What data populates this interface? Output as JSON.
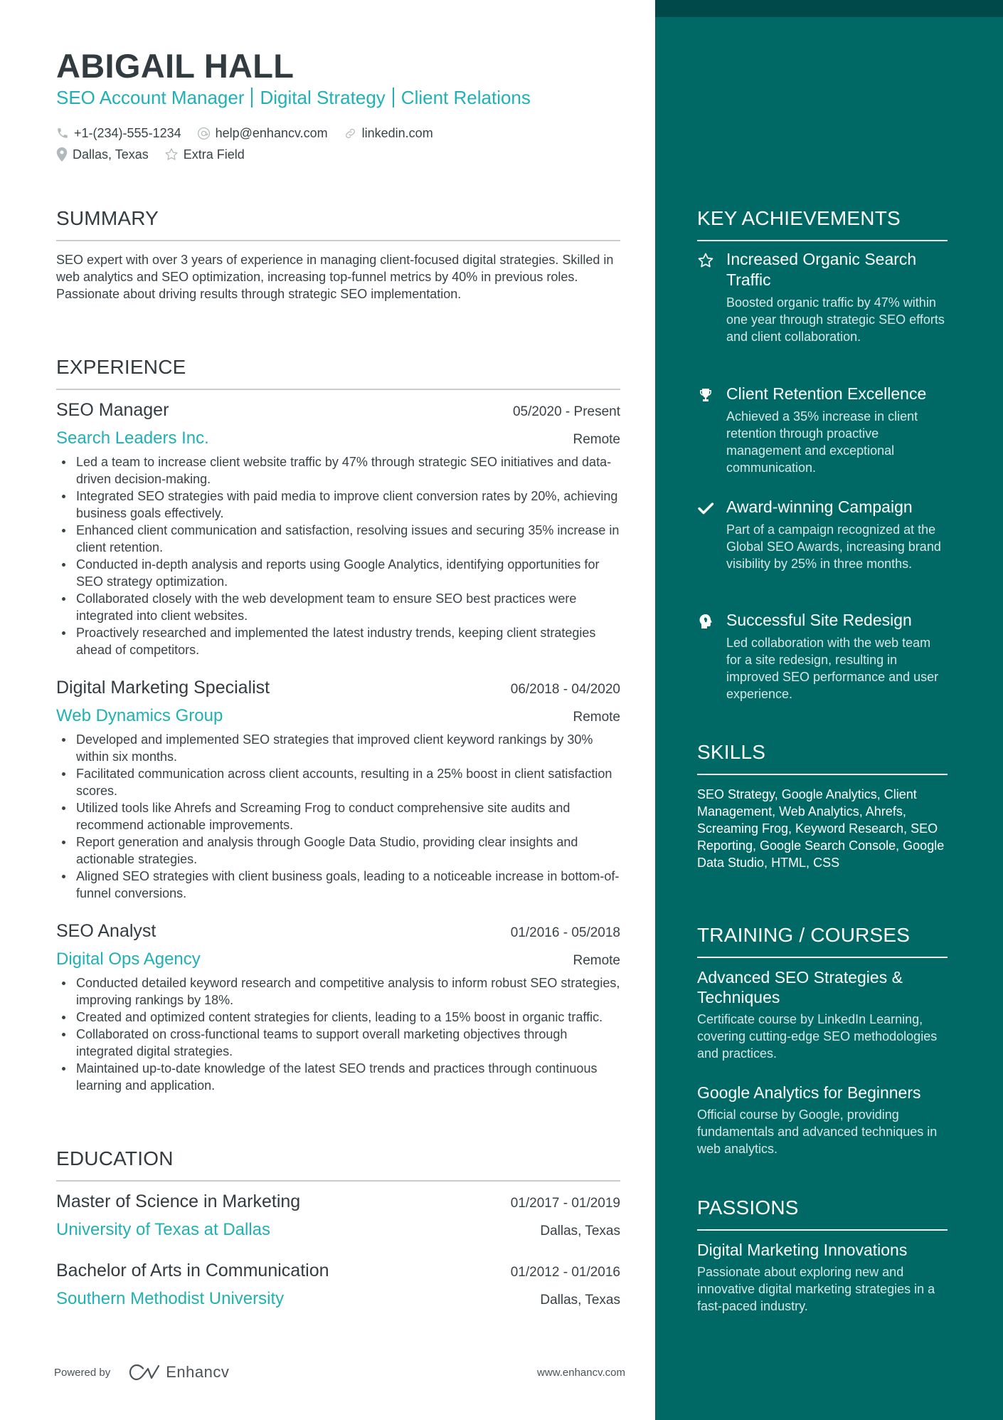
{
  "header": {
    "name": "ABIGAIL HALL",
    "title_parts": [
      "SEO Account Manager",
      "Digital Strategy",
      "Client Relations"
    ],
    "contacts": {
      "phone": {
        "icon": "phone-icon",
        "value": "+1-(234)-555-1234"
      },
      "email": {
        "icon": "at-icon",
        "value": "help@enhancv.com"
      },
      "linkedin": {
        "icon": "link-icon",
        "value": "linkedin.com"
      },
      "location": {
        "icon": "location-pin-icon",
        "value": "Dallas, Texas"
      },
      "extra": {
        "icon": "star-icon",
        "value": "Extra Field"
      }
    }
  },
  "summary": {
    "heading": "SUMMARY",
    "text": "SEO expert with over 3 years of experience in managing client-focused digital strategies. Skilled in web analytics and SEO optimization, increasing top-funnel metrics by 40% in previous roles. Passionate about driving results through strategic SEO implementation."
  },
  "experience": {
    "heading": "EXPERIENCE",
    "jobs": [
      {
        "title": "SEO Manager",
        "dates": "05/2020 - Present",
        "company": "Search Leaders Inc.",
        "location": "Remote",
        "bullets": [
          "Led a team to increase client website traffic by 47% through strategic SEO initiatives and data-driven decision-making.",
          "Integrated SEO strategies with paid media to improve client conversion rates by 20%, achieving business goals effectively.",
          "Enhanced client communication and satisfaction, resolving issues and securing 35% increase in client retention.",
          "Conducted in-depth analysis and reports using Google Analytics, identifying opportunities for SEO strategy optimization.",
          "Collaborated closely with the web development team to ensure SEO best practices were integrated into client websites.",
          "Proactively researched and implemented the latest industry trends, keeping client strategies ahead of competitors."
        ]
      },
      {
        "title": "Digital Marketing Specialist",
        "dates": "06/2018 - 04/2020",
        "company": "Web Dynamics Group",
        "location": "Remote",
        "bullets": [
          "Developed and implemented SEO strategies that improved client keyword rankings by 30% within six months.",
          "Facilitated communication across client accounts, resulting in a 25% boost in client satisfaction scores.",
          "Utilized tools like Ahrefs and Screaming Frog to conduct comprehensive site audits and recommend actionable improvements.",
          "Report generation and analysis through Google Data Studio, providing clear insights and actionable strategies.",
          "Aligned SEO strategies with client business goals, leading to a noticeable increase in bottom-of-funnel conversions."
        ]
      },
      {
        "title": "SEO Analyst",
        "dates": "01/2016 - 05/2018",
        "company": "Digital Ops Agency",
        "location": "Remote",
        "bullets": [
          "Conducted detailed keyword research and competitive analysis to inform robust SEO strategies, improving rankings by 18%.",
          "Created and optimized content strategies for clients, leading to a 15% boost in organic traffic.",
          "Collaborated on cross-functional teams to support overall marketing objectives through integrated digital strategies.",
          "Maintained up-to-date knowledge of the latest SEO trends and practices through continuous learning and application."
        ]
      }
    ]
  },
  "education": {
    "heading": "EDUCATION",
    "items": [
      {
        "degree": "Master of Science in Marketing",
        "dates": "01/2017 - 01/2019",
        "school": "University of Texas at Dallas",
        "location": "Dallas, Texas"
      },
      {
        "degree": "Bachelor of Arts in Communication",
        "dates": "01/2012 - 01/2016",
        "school": "Southern Methodist University",
        "location": "Dallas, Texas"
      }
    ]
  },
  "footer": {
    "powered_by": "Powered by",
    "brand": "Enhancv",
    "website": "www.enhancv.com"
  },
  "sidebar": {
    "achievements": {
      "heading": "KEY ACHIEVEMENTS",
      "items": [
        {
          "icon": "star-icon",
          "title": "Increased Organic Search Traffic",
          "description": "Boosted organic traffic by 47% within one year through strategic SEO efforts and client collaboration."
        },
        {
          "icon": "trophy-icon",
          "title": "Client Retention Excellence",
          "description": "Achieved a 35% increase in client retention through proactive management and exceptional communication."
        },
        {
          "icon": "checkmark-icon",
          "title": "Award-winning Campaign",
          "description": "Part of a campaign recognized at the Global SEO Awards, increasing brand visibility by 25% in three months."
        },
        {
          "icon": "head-idea-icon",
          "title": "Successful Site Redesign",
          "description": "Led collaboration with the web team for a site redesign, resulting in improved SEO performance and user experience."
        }
      ]
    },
    "skills": {
      "heading": "SKILLS",
      "text": "SEO Strategy, Google Analytics, Client Management, Web Analytics, Ahrefs, Screaming Frog, Keyword Research, SEO Reporting, Google Search Console, Google Data Studio, HTML, CSS"
    },
    "training": {
      "heading": "TRAINING / COURSES",
      "items": [
        {
          "title": "Advanced SEO Strategies & Techniques",
          "description": "Certificate course by LinkedIn Learning, covering cutting-edge SEO methodologies and practices."
        },
        {
          "title": "Google Analytics for Beginners",
          "description": "Official course by Google, providing fundamentals and advanced techniques in web analytics."
        }
      ]
    },
    "passions": {
      "heading": "PASSIONS",
      "items": [
        {
          "title": "Digital Marketing Innovations",
          "description": "Passionate about exploring new and innovative digital marketing strategies in a fast-paced industry."
        }
      ]
    }
  },
  "colors": {
    "accent": "#20b1b4",
    "sidebar_bg": "#006966",
    "sidebar_top": "#00494a",
    "text_dark": "#323b40"
  }
}
